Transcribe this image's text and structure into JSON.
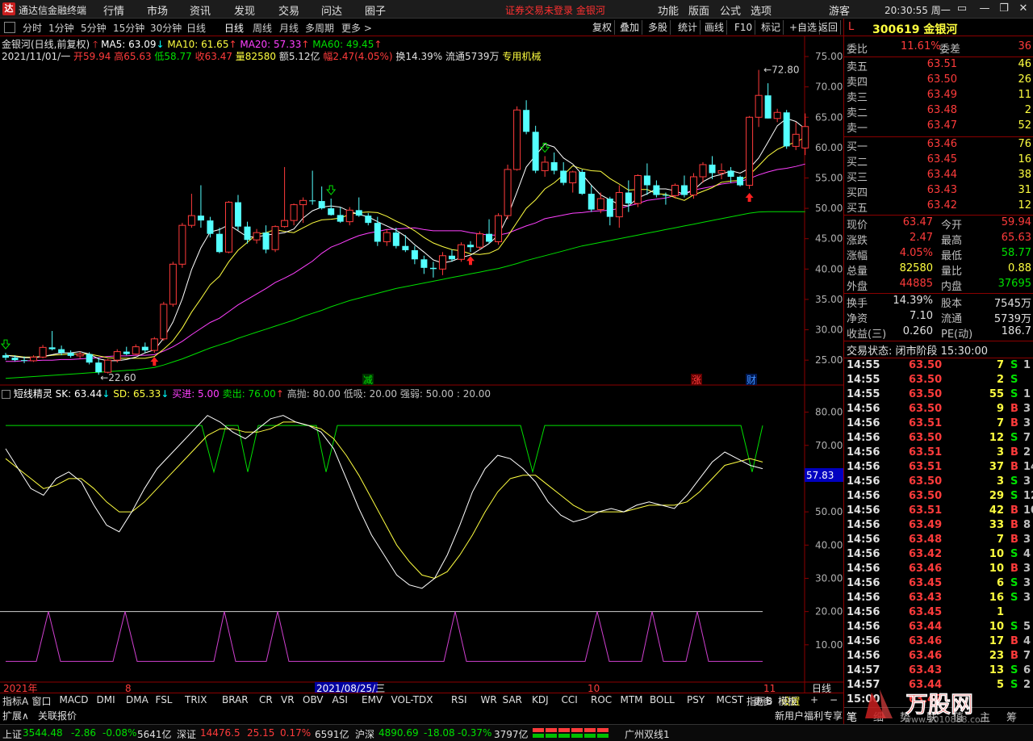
{
  "app": {
    "name": "通达信金融终端",
    "logo": "达",
    "menus": [
      "行情",
      "市场",
      "资讯",
      "发现",
      "交易",
      "问达",
      "圈子"
    ],
    "warning": "证券交易未登录  金银河",
    "right_menus": [
      "功能",
      "版面",
      "公式",
      "选项"
    ],
    "user": "游客",
    "clock": "20:30:55 周一"
  },
  "periods": [
    "分时",
    "1分钟",
    "5分钟",
    "15分钟",
    "30分钟",
    "日线",
    "周线",
    "月线",
    "多周期",
    "更多 >"
  ],
  "toolbar_right": [
    "复权",
    "叠加",
    "多股",
    "统计",
    "画线",
    "F10",
    "标记",
    "+自选",
    "返回"
  ],
  "chart": {
    "title_line": "金银河(日线,前复权)",
    "ma5": "MA5: 63.09",
    "ma10": "MA10: 61.65",
    "ma20": "MA20: 57.33",
    "ma60": "MA60: 49.45",
    "info_date": "2021/11/01/一",
    "info_open": "开59.94",
    "info_high": "高65.63",
    "info_low": "低58.77",
    "info_close": "收63.47",
    "info_vol": "量82580",
    "info_amt": "额5.12亿",
    "info_chg": "幅2.47(4.05%)",
    "info_turn": "换14.39%",
    "info_float": "流通5739万",
    "info_ind": "专用机械",
    "y_labels": [
      "75.00",
      "70.00",
      "65.00",
      "60.00",
      "55.00",
      "50.00",
      "45.00",
      "40.00",
      "35.00",
      "30.00",
      "25.00"
    ],
    "max_label": "72.80",
    "min_label": "22.60",
    "event_labels": [
      "减",
      "涨",
      "财"
    ],
    "x_labels": [
      "2021年",
      "8",
      "2021/08/25/三",
      "10",
      "11"
    ],
    "cursor_value": "57.83"
  },
  "chart_data": {
    "type": "candlestick",
    "ylim": [
      20.5,
      77
    ],
    "candles": [
      [
        25.8,
        26.2,
        25,
        25.4
      ],
      [
        25.4,
        25.8,
        24.8,
        25
      ],
      [
        25,
        25.6,
        24.5,
        24.9
      ],
      [
        24.9,
        25.8,
        24.7,
        25.5
      ],
      [
        25.5,
        27.5,
        25.3,
        27.1
      ],
      [
        27.1,
        29.8,
        26.6,
        26.8
      ],
      [
        26.8,
        27.4,
        25.8,
        26.2
      ],
      [
        26.2,
        26.6,
        25.4,
        25.7
      ],
      [
        25.7,
        26.4,
        25.2,
        26
      ],
      [
        26,
        26.3,
        24.3,
        24.6
      ],
      [
        24.6,
        25.4,
        22.6,
        23
      ],
      [
        23,
        25.2,
        22.8,
        25
      ],
      [
        25,
        26.8,
        24.6,
        26.4
      ],
      [
        26.4,
        27.2,
        25.8,
        26
      ],
      [
        26,
        27.6,
        25.9,
        27.2
      ],
      [
        27.2,
        27.9,
        26.2,
        26.6
      ],
      [
        26.6,
        28.8,
        26.2,
        28.5
      ],
      [
        28.5,
        34.6,
        28.2,
        34.2
      ],
      [
        34.2,
        41.2,
        33.8,
        40.8
      ],
      [
        40.8,
        47.6,
        40.2,
        47.2
      ],
      [
        47.2,
        52.4,
        46.8,
        48.8
      ],
      [
        48.8,
        53.8,
        46.8,
        48
      ],
      [
        48,
        48.6,
        45.2,
        45.8
      ],
      [
        45.8,
        46.8,
        42.6,
        42.8
      ],
      [
        42.8,
        51.2,
        42.6,
        51
      ],
      [
        51,
        52.2,
        46.4,
        47
      ],
      [
        47,
        47.8,
        44.2,
        44.8
      ],
      [
        44.8,
        46.6,
        44.2,
        46
      ],
      [
        46,
        47.2,
        42.6,
        43.2
      ],
      [
        43.2,
        47.2,
        42.8,
        47
      ],
      [
        47,
        56.8,
        46.8,
        48
      ],
      [
        48,
        50.8,
        47.2,
        50.6
      ],
      [
        50.6,
        51.8,
        47.6,
        51.3
      ],
      [
        51.3,
        56.2,
        50.6,
        51.2
      ],
      [
        51.2,
        53.6,
        49.8,
        50
      ],
      [
        50,
        51.6,
        48.8,
        48.9
      ],
      [
        48.9,
        50.2,
        47.6,
        47.8
      ],
      [
        47.8,
        50.2,
        47.2,
        49.7
      ],
      [
        49.7,
        51.8,
        48.6,
        48.8
      ],
      [
        48.8,
        49.2,
        47.2,
        47.6
      ],
      [
        47.6,
        48.6,
        43.8,
        44.5
      ],
      [
        44.5,
        46.6,
        43.8,
        46
      ],
      [
        46,
        46.8,
        43.4,
        43.8
      ],
      [
        43.8,
        45.6,
        42.8,
        43.1
      ],
      [
        43.1,
        43.8,
        40.8,
        41.6
      ],
      [
        41.6,
        42.2,
        39.2,
        40.2
      ],
      [
        40.2,
        41.2,
        38.6,
        40
      ],
      [
        40,
        42.8,
        39,
        42.2
      ],
      [
        42.2,
        43.2,
        41.2,
        41.6
      ],
      [
        41.6,
        44.4,
        41.2,
        44
      ],
      [
        44,
        44.6,
        42.8,
        43.6
      ],
      [
        43.6,
        46.2,
        43.1,
        45.8
      ],
      [
        45.8,
        48.2,
        44.2,
        44.5
      ],
      [
        44.5,
        49.2,
        44,
        48.8
      ],
      [
        48.8,
        57.2,
        48.2,
        56.4
      ],
      [
        56.4,
        66.8,
        56.2,
        66.2
      ],
      [
        66.2,
        67.8,
        62.2,
        62.6
      ],
      [
        62.6,
        63.6,
        55.8,
        56.2
      ],
      [
        56.2,
        58.6,
        55.2,
        57.6
      ],
      [
        57.6,
        59.2,
        55.6,
        56.2
      ],
      [
        56.2,
        57.6,
        53.8,
        54.2
      ],
      [
        54.2,
        56.2,
        52.6,
        56
      ],
      [
        56,
        56.4,
        52.2,
        52.4
      ],
      [
        52.4,
        53.8,
        49.4,
        49.8
      ],
      [
        49.8,
        52.6,
        49.2,
        51.6
      ],
      [
        51.6,
        51.9,
        47.2,
        48.6
      ],
      [
        48.6,
        53.8,
        46.8,
        52.6
      ],
      [
        52.6,
        54.6,
        49.4,
        50.8
      ],
      [
        50.8,
        55.6,
        50.2,
        55.4
      ],
      [
        55.4,
        57.4,
        52.2,
        53.8
      ],
      [
        53.8,
        54.6,
        51.8,
        52.2
      ],
      [
        52.2,
        52.6,
        50.6,
        52.1
      ],
      [
        52.1,
        54.1,
        51.6,
        53.8
      ],
      [
        53.8,
        55.4,
        51.8,
        52.2
      ],
      [
        52.2,
        55.8,
        51.6,
        55.2
      ],
      [
        55.2,
        57.6,
        54.2,
        57.2
      ],
      [
        57.2,
        58.6,
        54.8,
        55.8
      ],
      [
        55.8,
        57.4,
        54.8,
        56.2
      ],
      [
        56.2,
        56.8,
        54.2,
        55.2
      ],
      [
        55.2,
        55.4,
        53.6,
        53.8
      ],
      [
        53.8,
        65.2,
        53.2,
        65
      ],
      [
        65,
        72.8,
        63.4,
        68.6
      ],
      [
        68.6,
        70.6,
        64.8,
        64.8
      ],
      [
        64.8,
        66.4,
        64.2,
        65.8
      ],
      [
        65.8,
        66.2,
        59.8,
        60.2
      ],
      [
        60.2,
        64.2,
        59.6,
        62.2
      ],
      [
        59.94,
        65.63,
        58.77,
        63.47
      ]
    ],
    "ma5": [
      25.8,
      25.6,
      25.4,
      25.4,
      25.6,
      25.9,
      26.2,
      26.2,
      26.4,
      26,
      25.2,
      24.9,
      24.9,
      25.1,
      25.5,
      26.2,
      26.7,
      28.6,
      31.3,
      35.1,
      39.9,
      43.5,
      46.1,
      46.5,
      47.3,
      46.3,
      45.3,
      45.3,
      45.6,
      45.8,
      46,
      46.6,
      48.4,
      49.6,
      50.2,
      50.4,
      50.2,
      49.5,
      49,
      48.6,
      47.8,
      47.1,
      46.4,
      45.4,
      44,
      42.8,
      41.5,
      41,
      41.3,
      41.9,
      42.3,
      43.2,
      44.2,
      45.6,
      48.7,
      52.7,
      56.8,
      58.7,
      60.6,
      60.1,
      58.3,
      57.3,
      55.6,
      53.8,
      52.2,
      51.4,
      50.6,
      50.4,
      51.7,
      52.4,
      53.2,
      53.2,
      52.9,
      52.3,
      53,
      54.4,
      55.2,
      55.6,
      56.2,
      55.8,
      56.6,
      58.3,
      60.9,
      63.6,
      64.8,
      64.3,
      63.1
    ],
    "ma10": [
      25.8,
      25.7,
      25.5,
      25.5,
      25.6,
      25.8,
      25.9,
      26,
      26,
      26,
      25.7,
      25.4,
      25.3,
      25.3,
      25.3,
      25.3,
      25.6,
      26.8,
      28.2,
      30.3,
      32.9,
      35.1,
      37.4,
      38.8,
      41.2,
      43.1,
      44.4,
      45.7,
      46,
      46.5,
      46.2,
      46,
      46.8,
      47.6,
      48.1,
      48.2,
      48.4,
      49,
      49.3,
      49.4,
      49.3,
      48.7,
      47.9,
      47.2,
      46.3,
      45.2,
      44.3,
      43.7,
      43.2,
      43,
      42.5,
      42.4,
      42.6,
      43.3,
      45.4,
      47.7,
      50,
      51.4,
      53.2,
      54.2,
      55.5,
      57,
      56.5,
      56.2,
      56.1,
      54.9,
      54,
      53,
      53.1,
      53.1,
      52.4,
      52.3,
      51.8,
      51.3,
      52.2,
      52.8,
      53.4,
      54.3,
      54.5,
      54.6,
      55.5,
      57,
      58.6,
      59.7,
      60.4,
      60.9,
      61.7
    ],
    "ma20": [
      24.8,
      24.8,
      24.9,
      24.9,
      25,
      25,
      25.1,
      25.1,
      25.2,
      25.3,
      25.4,
      25.6,
      25.7,
      25.7,
      25.8,
      25.8,
      25.9,
      26.5,
      27.2,
      28.1,
      29.2,
      30.2,
      31.2,
      31.9,
      33,
      34.1,
      35,
      35.9,
      36.8,
      37.8,
      38.5,
      39.3,
      40.3,
      41.3,
      42.6,
      43.6,
      44.2,
      44.9,
      45.5,
      45.9,
      46.2,
      46.5,
      46.6,
      46.7,
      46.8,
      46.5,
      46.3,
      46.3,
      46.3,
      46.3,
      46,
      45.8,
      45.6,
      45.6,
      45.9,
      46.5,
      47.1,
      47.6,
      48.3,
      48.6,
      48.9,
      49.2,
      49.3,
      49.5,
      49.6,
      49.7,
      50,
      50.4,
      50.8,
      51.3,
      51.5,
      51.7,
      52.1,
      52.5,
      53,
      53.3,
      53.6,
      54,
      54.2,
      54.4,
      54.9,
      55.5,
      56,
      56.4,
      56.6,
      56.9,
      57.3
    ],
    "ma60": [
      22,
      22.1,
      22.2,
      22.3,
      22.4,
      22.5,
      22.6,
      22.7,
      22.8,
      22.9,
      23,
      23.1,
      23.2,
      23.3,
      23.4,
      23.6,
      23.8,
      24.2,
      24.7,
      25.2,
      25.8,
      26.4,
      27,
      27.5,
      28,
      28.6,
      29.1,
      29.6,
      30.1,
      30.6,
      31.1,
      31.6,
      32.2,
      32.7,
      33.2,
      33.8,
      34.3,
      34.8,
      35.2,
      35.6,
      36,
      36.4,
      36.8,
      37.1,
      37.4,
      37.7,
      38,
      38.3,
      38.6,
      38.9,
      39.2,
      39.5,
      39.8,
      40.1,
      40.5,
      40.9,
      41.4,
      41.8,
      42.2,
      42.6,
      43,
      43.4,
      43.8,
      44.1,
      44.4,
      44.7,
      45,
      45.3,
      45.6,
      45.9,
      46.2,
      46.5,
      46.8,
      47.1,
      47.4,
      47.7,
      48,
      48.3,
      48.6,
      48.9,
      49.2,
      49.4,
      49.45,
      49.45,
      49.45,
      49.45,
      49.45
    ],
    "osc": {
      "sk_label": "短线精灵  SK: 63.44",
      "sd_label": "SD: 65.33",
      "buy_label": "买进: 5.00",
      "sell_label": "卖出: 76.00",
      "hi_label": "高抛: 80.00",
      "lo_label": "低吸: 20.00",
      "mid_label": "强弱: 50.00 : 20.00",
      "y_labels": [
        "80.00",
        "70.00",
        "60.00",
        "50.00",
        "40.00",
        "30.00",
        "20.00",
        "10.00"
      ],
      "ylim": [
        0,
        85
      ]
    }
  },
  "rightpanel": {
    "code": "L",
    "stock": "300619 金银河",
    "weibi_label": "委比",
    "weibi": "11.61%",
    "weicha_label": "委差",
    "weicha": "36",
    "sell": [
      {
        "l": "卖五",
        "p": "63.51",
        "v": "46"
      },
      {
        "l": "卖四",
        "p": "63.50",
        "v": "26"
      },
      {
        "l": "卖三",
        "p": "63.49",
        "v": "11"
      },
      {
        "l": "卖二",
        "p": "63.48",
        "v": "2"
      },
      {
        "l": "卖一",
        "p": "63.47",
        "v": "52"
      }
    ],
    "buy": [
      {
        "l": "买一",
        "p": "63.46",
        "v": "76"
      },
      {
        "l": "买二",
        "p": "63.45",
        "v": "16"
      },
      {
        "l": "买三",
        "p": "63.44",
        "v": "38"
      },
      {
        "l": "买四",
        "p": "63.43",
        "v": "31"
      },
      {
        "l": "买五",
        "p": "63.42",
        "v": "12"
      }
    ],
    "stats": [
      {
        "a": "现价",
        "b": "63.47",
        "c": "今开",
        "d": "59.94",
        "bc": "#ff3b3b",
        "dc": "#ff3b3b"
      },
      {
        "a": "涨跌",
        "b": "2.47",
        "c": "最高",
        "d": "65.63",
        "bc": "#ff3b3b",
        "dc": "#ff3b3b"
      },
      {
        "a": "涨幅",
        "b": "4.05%",
        "c": "最低",
        "d": "58.77",
        "bc": "#ff3b3b",
        "dc": "#00e000"
      },
      {
        "a": "总量",
        "b": "82580",
        "c": "量比",
        "d": "0.88",
        "bc": "#ffff40",
        "dc": "#ffff40"
      },
      {
        "a": "外盘",
        "b": "44885",
        "c": "内盘",
        "d": "37695",
        "bc": "#ff3b3b",
        "dc": "#00e000"
      }
    ],
    "stats2": [
      {
        "a": "换手",
        "b": "14.39%",
        "c": "股本",
        "d": "7545万"
      },
      {
        "a": "净资",
        "b": "7.10",
        "c": "流通",
        "d": "5739万"
      },
      {
        "a": "收益(三)",
        "b": "0.260",
        "c": "PE(动)",
        "d": "186.7"
      }
    ],
    "trade_status": "交易状态: 闭市阶段 15:30:00",
    "ticks": [
      [
        "14:55",
        "63.50",
        "7",
        "S",
        "1"
      ],
      [
        "14:55",
        "63.50",
        "2",
        "S",
        ""
      ],
      [
        "14:55",
        "63.50",
        "55",
        "S",
        "1"
      ],
      [
        "14:56",
        "63.50",
        "9",
        "B",
        "3"
      ],
      [
        "14:56",
        "63.51",
        "7",
        "B",
        "3"
      ],
      [
        "14:56",
        "63.50",
        "12",
        "S",
        "7"
      ],
      [
        "14:56",
        "63.51",
        "3",
        "B",
        "2"
      ],
      [
        "14:56",
        "63.51",
        "37",
        "B",
        "14"
      ],
      [
        "14:56",
        "63.50",
        "3",
        "S",
        "3"
      ],
      [
        "14:56",
        "63.50",
        "29",
        "S",
        "12"
      ],
      [
        "14:56",
        "63.51",
        "42",
        "B",
        "10"
      ],
      [
        "14:56",
        "63.49",
        "33",
        "B",
        "8"
      ],
      [
        "14:56",
        "63.48",
        "7",
        "B",
        "3"
      ],
      [
        "14:56",
        "63.42",
        "10",
        "S",
        "4"
      ],
      [
        "14:56",
        "63.46",
        "10",
        "B",
        "3"
      ],
      [
        "14:56",
        "63.45",
        "6",
        "S",
        "3"
      ],
      [
        "14:56",
        "63.43",
        "16",
        "S",
        "3"
      ],
      [
        "14:56",
        "63.45",
        "1",
        "",
        ""
      ],
      [
        "14:56",
        "63.44",
        "10",
        "S",
        "5"
      ],
      [
        "14:56",
        "63.46",
        "17",
        "B",
        "4"
      ],
      [
        "14:56",
        "63.46",
        "23",
        "B",
        "7"
      ],
      [
        "14:57",
        "63.43",
        "13",
        "S",
        "6"
      ],
      [
        "14:57",
        "63.44",
        "5",
        "S",
        "2"
      ],
      [
        "15:00",
        "63.47",
        "",
        "",
        ""
      ]
    ],
    "tabs": [
      "笔",
      "细",
      "势",
      "联",
      "值",
      "主",
      "筹"
    ]
  },
  "bottom_tabs": [
    "指标A",
    "窗口",
    "MACD",
    "DMI",
    "DMA",
    "FSL",
    "TRIX",
    "BRAR",
    "CR",
    "VR",
    "OBV",
    "ASI",
    "EMV",
    "VOL-TDX",
    "RSI",
    "WR",
    "SAR",
    "KDJ",
    "CCI",
    "ROC",
    "MTM",
    "BOLL",
    "PSY",
    "MCST",
    "更多",
    "设置"
  ],
  "bottom_right": [
    "指标B",
    "模板",
    "+",
    "−",
    "日线"
  ],
  "bottom_tabs2": [
    "扩展∧",
    "关联报价"
  ],
  "bottom_tabs2_right": "新用户福利专享",
  "status": {
    "sh_label": "上证",
    "sh": "3544.48",
    "sh_chg": "-2.86",
    "sh_pct": "-0.08%",
    "sh_amt": "5641亿",
    "sz_label": "深证",
    "sz": "14476.5",
    "sz_chg": "25.15",
    "sz_pct": "0.17%",
    "sz_amt": "6591亿",
    "hs_label": "沪深",
    "hs": "4890.69",
    "hs_chg": "-18.08",
    "hs_pct": "-0.37%",
    "hs_amt": "3797亿",
    "broker": "广州双线1"
  },
  "watermark": {
    "brand": "万股网",
    "url": "www.2010888.com"
  },
  "colors": {
    "up": "#ff3b3b",
    "down": "#54ffff",
    "ma5": "#ffffff",
    "ma10": "#ffff40",
    "ma20": "#ff40ff",
    "ma60": "#00e000",
    "green": "#00e000",
    "magenta": "#d040d0",
    "yellow": "#ffff40",
    "red": "#ff3b3b"
  }
}
